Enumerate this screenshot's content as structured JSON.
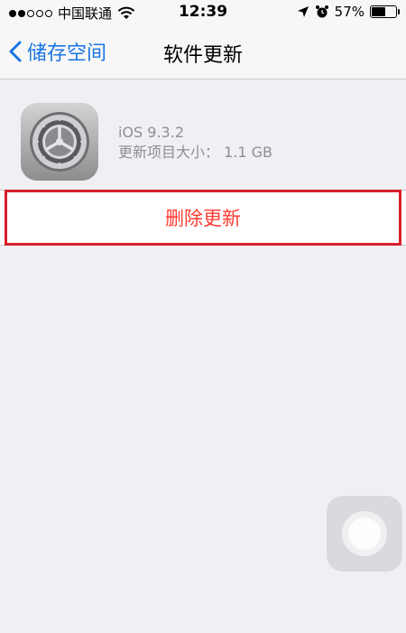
{
  "status_bar": {
    "carrier": "中国联通",
    "time": "12:39",
    "battery_percent": "57%",
    "battery_level": 0.57,
    "icons": [
      "signal-dots",
      "wifi-icon",
      "location-arrow-icon",
      "alarm-clock-icon",
      "battery-icon"
    ]
  },
  "nav": {
    "back_label": "储存空间",
    "title": "软件更新"
  },
  "update": {
    "icon": "settings-gear-icon",
    "name": "iOS 9.3.2",
    "size_label": "更新项目大小：",
    "size_value": "1.1 GB"
  },
  "actions": {
    "delete_label": "删除更新"
  },
  "colors": {
    "accent": "#1a74e5",
    "destructive": "#ff3b30",
    "highlight": "#d8202a",
    "background": "#efeff4"
  }
}
